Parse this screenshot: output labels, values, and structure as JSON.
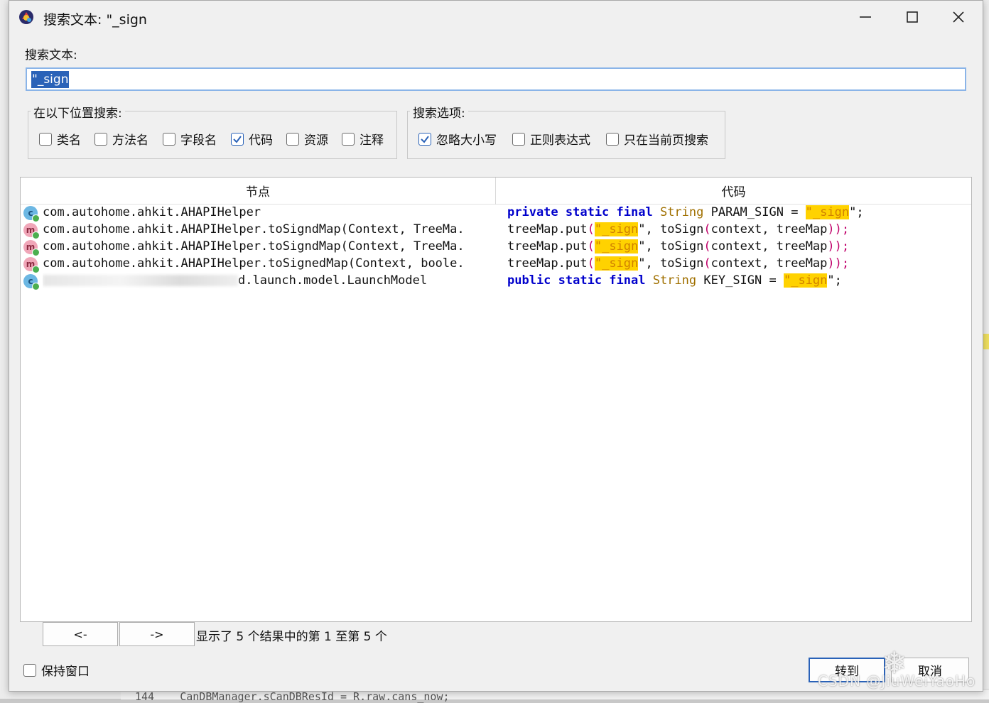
{
  "window": {
    "title": "搜索文本: \"_sign",
    "controls": {
      "minimize": "minimize-icon",
      "maximize": "maximize-icon",
      "close": "close-icon"
    }
  },
  "search": {
    "label": "搜索文本:",
    "value": "\"_sign"
  },
  "location_group": {
    "legend": "在以下位置搜索:",
    "options": [
      {
        "label": "类名",
        "checked": false
      },
      {
        "label": "方法名",
        "checked": false
      },
      {
        "label": "字段名",
        "checked": false
      },
      {
        "label": "代码",
        "checked": true
      },
      {
        "label": "资源",
        "checked": false
      },
      {
        "label": "注释",
        "checked": false
      }
    ]
  },
  "options_group": {
    "legend": "搜索选项:",
    "options": [
      {
        "label": "忽略大小写",
        "checked": true
      },
      {
        "label": "正则表达式",
        "checked": false
      },
      {
        "label": "只在当前页搜索",
        "checked": false
      }
    ]
  },
  "results": {
    "columns": {
      "node": "节点",
      "code": "代码"
    },
    "rows": [
      {
        "icon": "c",
        "node": "com.autohome.ahkit.AHAPIHelper",
        "code": {
          "prefix_kw": "private static final",
          "type": "String",
          "name": " PARAM_SIGN = ",
          "match": "\"_sign",
          "suffix": "\";"
        }
      },
      {
        "icon": "m",
        "node": "com.autohome.ahkit.AHAPIHelper.toSigndMap(Context, TreeMa.",
        "code": {
          "pre": "treeMap.put",
          "paren_open": "(",
          "match": "\"_sign",
          "post": "\", toSign",
          "paren2_open": "(",
          "args": "context, treeMap",
          "paren_close": "));"
        }
      },
      {
        "icon": "m",
        "node": "com.autohome.ahkit.AHAPIHelper.toSigndMap(Context, TreeMa.",
        "code": {
          "pre": "treeMap.put",
          "paren_open": "(",
          "match": "\"_sign",
          "post": "\", toSign",
          "paren2_open": "(",
          "args": "context, treeMap",
          "paren_close": "));"
        }
      },
      {
        "icon": "m",
        "node": "com.autohome.ahkit.AHAPIHelper.toSignedMap(Context, boole.",
        "code": {
          "pre": "treeMap.put",
          "paren_open": "(",
          "match": "\"_sign",
          "post": "\", toSign",
          "paren2_open": "(",
          "args": "context, treeMap",
          "paren_close": "));"
        }
      },
      {
        "icon": "c",
        "node_visible_suffix": "d.launch.model.LaunchModel",
        "code": {
          "prefix_kw": "public static final",
          "type": "String",
          "name": " KEY_SIGN = ",
          "match": "\"_sign",
          "suffix": "\";"
        }
      }
    ]
  },
  "pager": {
    "prev_label": "<-",
    "next_label": "->",
    "status": "显示了 5 个结果中的第 1 至第 5 个"
  },
  "footer": {
    "keep_window_label": "保持窗口",
    "keep_window_checked": false,
    "goto_label": "转到",
    "cancel_label": "取消"
  },
  "background_editor": {
    "line_number": "144",
    "line_code": "CanDBManager.sCanDBResId = R.raw.cans_now;"
  },
  "watermark": "CSDN @JiuWeiYaoHo",
  "colors": {
    "accent": "#2a62b8",
    "keyword": "#0000cc",
    "type": "#a07000",
    "highlight": "#ffd200"
  }
}
